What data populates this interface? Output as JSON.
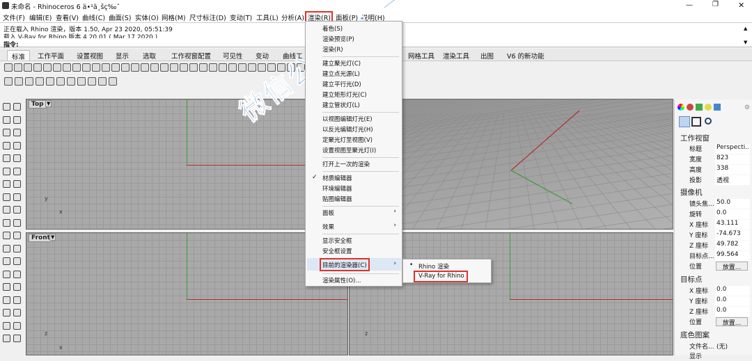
{
  "window": {
    "title": "未命名 - Rhinoceros 6 ä•¹ä¸šç‰ˆ"
  },
  "menubar": {
    "items": [
      "文件(F)",
      "编辑(E)",
      "查看(V)",
      "曲线(C)",
      "曲面(S)",
      "实体(O)",
      "网格(M)",
      "尺寸标注(D)",
      "变动(T)",
      "工具(L)",
      "分析(A)",
      "渲染(R)",
      "面板(P)",
      "说明(H)"
    ]
  },
  "command": {
    "line1": "正在载入 Rhino 渲染，版本 1.50, Apr 23 2020, 05:51:39",
    "line2": "载入 V-Ray for Rhino 版本 4.20.01 ( Mar 17 2020 )",
    "prompt": "指令:"
  },
  "tabs": [
    "标准",
    "工作平面",
    "设置视图",
    "显示",
    "选取",
    "工作视窗配置",
    "可见性",
    "变动",
    "曲线工",
    "网格工具",
    "渲染工具",
    "出图",
    "V6 的新功能"
  ],
  "viewports": {
    "top": "Top",
    "front": "Front",
    "axis_x": "x",
    "axis_y": "y",
    "axis_z": "z"
  },
  "render_menu": {
    "items": [
      "着色(S)",
      "渲染预览(P)",
      "渲染(R)",
      "建立聚光灯(C)",
      "建立点光源(L)",
      "建立平行光(D)",
      "建立矩形灯光(C)",
      "建立管状灯(L)",
      "以视图编辑灯光(E)",
      "以反光编辑灯光(H)",
      "定聚光灯至视图(V)",
      "设置视图至聚光灯(I)",
      "打开上一次的渲染",
      "材质编辑器",
      "环境编辑器",
      "贴图编辑器",
      "面板",
      "效果",
      "显示安全框",
      "安全框设置",
      "目前的渲染器(C)",
      "渲染属性(O)..."
    ]
  },
  "submenu": {
    "items": [
      "Rhino 渲染",
      "V-Ray for Rhino"
    ]
  },
  "right_panel": {
    "section1": "工作视窗",
    "rows1": [
      [
        "标题",
        "Perspecti..."
      ],
      [
        "宽度",
        "823"
      ],
      [
        "高度",
        "338"
      ],
      [
        "投影",
        "透视"
      ]
    ],
    "section2": "摄像机",
    "rows2": [
      [
        "镜头焦...",
        "50.0"
      ],
      [
        "旋转",
        "0.0"
      ],
      [
        "X 座标",
        "43.111"
      ],
      [
        "Y 座标",
        "-74.673"
      ],
      [
        "Z 座标",
        "49.782"
      ],
      [
        "目标点...",
        "99.564"
      ],
      [
        "位置",
        "放置..."
      ]
    ],
    "section3": "目标点",
    "rows3": [
      [
        "X 座标",
        "0.0"
      ],
      [
        "Y 座标",
        "0.0"
      ],
      [
        "Z 座标",
        "0.0"
      ],
      [
        "位置",
        "放置..."
      ]
    ],
    "section4": "底色图案",
    "rows4": [
      [
        "文件名...",
        "(无)"
      ],
      [
        "显示",
        ""
      ]
    ]
  },
  "watermark": "微信公众号：一起学犀牛",
  "colors": {
    "accent": "#e0302a",
    "watermark": "#2882e6"
  }
}
